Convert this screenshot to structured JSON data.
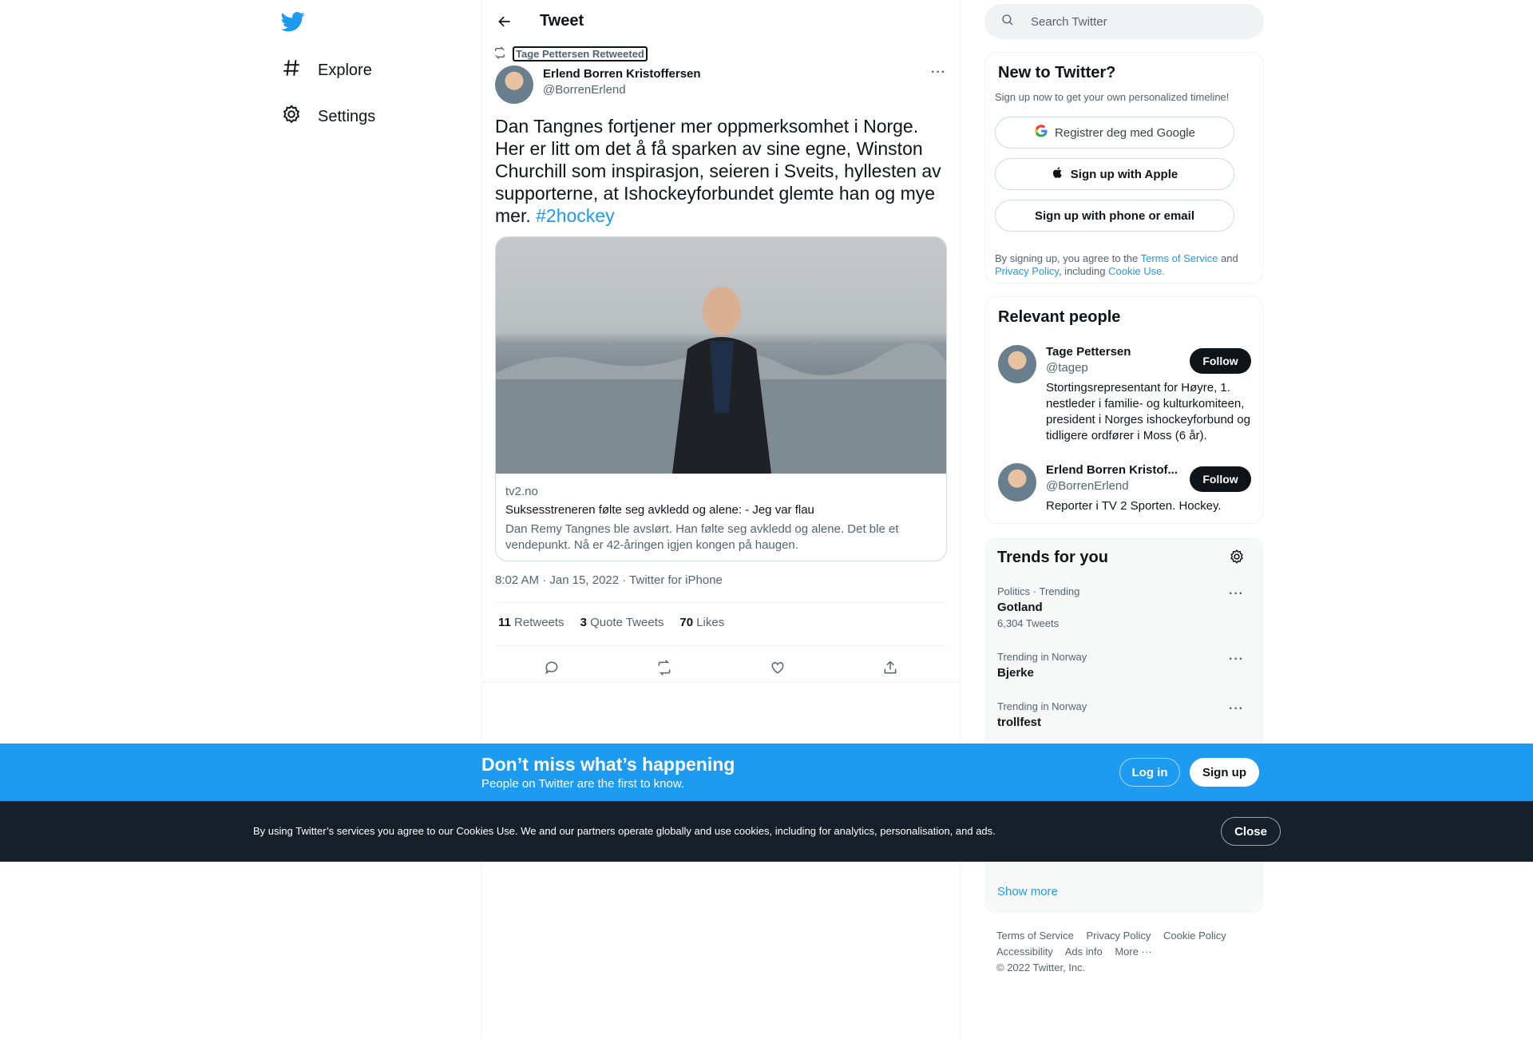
{
  "nav": {
    "logo_icon": "twitter-bird-icon",
    "items": [
      {
        "label": "Explore",
        "icon": "hashtag-icon"
      },
      {
        "label": "Settings",
        "icon": "gear-icon"
      }
    ]
  },
  "header": {
    "title": "Tweet"
  },
  "tweet": {
    "retweeted_by": "Tage Pettersen Retweeted",
    "author_name": "Erlend Borren Kristoffersen",
    "author_handle": "@BorrenErlend",
    "text": "Dan Tangnes fortjener mer oppmerksomhet i Norge. Her er litt om det å få sparken av sine egne, Winston Churchill som inspirasjon, seieren i Sveits, hyllesten av supporterne, at Ishockeyforbundet glemte han og mye mer.",
    "hashtag": "#2hockey",
    "card": {
      "domain": "tv2.no",
      "title": "Suksesstreneren følte seg avkledd og alene: - Jeg var flau",
      "description": "Dan Remy Tangnes ble avslørt. Han følte seg avkledd og alene. Det ble et vendepunkt. Nå er 42-åringen igjen kongen på haugen."
    },
    "timestamp": "8:02 AM · Jan 15, 2022 · Twitter for iPhone",
    "stats": {
      "retweets_count": "11",
      "retweets_label": "Retweets",
      "quotes_count": "3",
      "quotes_label": "Quote Tweets",
      "likes_count": "70",
      "likes_label": "Likes"
    }
  },
  "search": {
    "placeholder": "Search Twitter"
  },
  "signup_panel": {
    "title": "New to Twitter?",
    "subtitle": "Sign up now to get your own personalized timeline!",
    "google_label": "Registrer deg med Google",
    "apple_label": "Sign up with Apple",
    "phone_label": "Sign up with phone or email",
    "terms_prefix": "By signing up, you agree to the",
    "terms_link": "Terms of Service",
    "terms_and": "and",
    "privacy_link": "Privacy Policy",
    "terms_including": ", including",
    "cookie_link": "Cookie Use."
  },
  "relevant": {
    "title": "Relevant people",
    "people": [
      {
        "name": "Tage Pettersen",
        "handle": "@tagep",
        "bio": "Stortingsrepresentant for Høyre, 1. nestleder i familie- og kulturkomiteen, president i Norges ishockeyforbund og tidligere ordfører i Moss (6 år).",
        "follow": "Follow"
      },
      {
        "name": "Erlend Borren Kristof...",
        "handle": "@BorrenErlend",
        "bio": "Reporter i TV 2 Sporten. Hockey.",
        "follow": "Follow"
      }
    ]
  },
  "trends": {
    "title": "Trends for you",
    "items": [
      {
        "category": "Politics · Trending",
        "name": "Gotland",
        "count": "6,304 Tweets"
      },
      {
        "category": "Trending in Norway",
        "name": "Bjerke",
        "count": ""
      },
      {
        "category": "Trending in Norway",
        "name": "trollfest",
        "count": ""
      }
    ],
    "show_more": "Show more"
  },
  "footer": {
    "links": [
      "Terms of Service",
      "Privacy Policy",
      "Cookie Policy",
      "Accessibility",
      "Ads info",
      "More ···"
    ],
    "copyright": "© 2022 Twitter, Inc."
  },
  "banner": {
    "title": "Don’t miss what’s happening",
    "subtitle": "People on Twitter are the first to know.",
    "login": "Log in",
    "signup": "Sign up"
  },
  "cookie": {
    "text": "By using Twitter’s services you agree to our Cookies Use. We and our partners operate globally and use cookies, including for analytics, personalisation, and ads.",
    "close": "Close"
  },
  "colors": {
    "accent": "#1d9bf0",
    "text": "#0f1419",
    "muted": "#536471",
    "cookie_bg": "#15202b"
  }
}
